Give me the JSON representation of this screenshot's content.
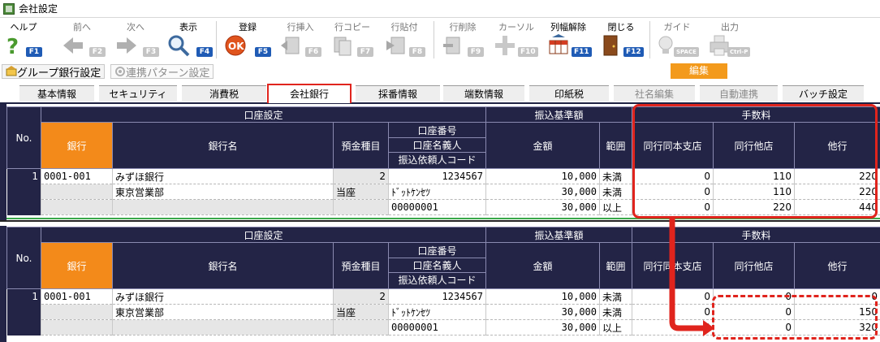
{
  "window": {
    "title": "会社設定"
  },
  "toolbar": {
    "items": [
      {
        "label": "ヘルプ",
        "key": "F1",
        "enabled": true,
        "icon": "help-icon"
      },
      {
        "label": "前へ",
        "key": "F2",
        "enabled": false,
        "icon": "arrow-left-icon"
      },
      {
        "label": "次へ",
        "key": "F3",
        "enabled": false,
        "icon": "arrow-right-icon"
      },
      {
        "label": "表示",
        "key": "F4",
        "enabled": true,
        "icon": "magnifier-icon"
      },
      {
        "label": "登録",
        "key": "F5",
        "enabled": true,
        "icon": "ok-icon"
      },
      {
        "label": "行挿入",
        "key": "F6",
        "enabled": false,
        "icon": "row-insert-icon"
      },
      {
        "label": "行コピー",
        "key": "F7",
        "enabled": false,
        "icon": "row-copy-icon"
      },
      {
        "label": "行貼付",
        "key": "F8",
        "enabled": false,
        "icon": "row-paste-icon"
      },
      {
        "label": "行削除",
        "key": "F9",
        "enabled": false,
        "icon": "row-delete-icon"
      },
      {
        "label": "カーソル",
        "key": "F10",
        "enabled": false,
        "icon": "cursor-icon"
      },
      {
        "label": "列幅解除",
        "key": "F11",
        "enabled": true,
        "icon": "column-width-icon"
      },
      {
        "label": "閉じる",
        "key": "F12",
        "enabled": true,
        "icon": "door-icon"
      },
      {
        "label": "ガイド",
        "key": "SPACE",
        "enabled": false,
        "icon": "bulb-icon"
      },
      {
        "label": "出力",
        "key": "Ctrl-P",
        "enabled": false,
        "icon": "printer-icon"
      }
    ]
  },
  "subbar": {
    "group_bank_label": "グループ銀行設定",
    "link_pattern_label": "連携パターン設定",
    "edit_label": "編集"
  },
  "tabs": [
    {
      "label": "基本情報",
      "active": false,
      "enabled": true
    },
    {
      "label": "セキュリティ",
      "active": false,
      "enabled": true
    },
    {
      "label": "消費税",
      "active": false,
      "enabled": true
    },
    {
      "label": "会社銀行",
      "active": true,
      "enabled": true
    },
    {
      "label": "採番情報",
      "active": false,
      "enabled": true
    },
    {
      "label": "端数情報",
      "active": false,
      "enabled": true
    },
    {
      "label": "印紙税",
      "active": false,
      "enabled": true
    },
    {
      "label": "社名編集",
      "active": false,
      "enabled": false
    },
    {
      "label": "自動連携",
      "active": false,
      "enabled": false
    },
    {
      "label": "バッチ設定",
      "active": false,
      "enabled": true
    }
  ],
  "grid_header": {
    "no": "No.",
    "account_settings": "口座設定",
    "transfer_base": "振込基準額",
    "fee": "手数料",
    "bank": "銀行",
    "bank_name": "銀行名",
    "deposit_type": "預金種目",
    "account_no": "口座番号",
    "account_holder": "口座名義人",
    "requester_code": "振込依頼人コード",
    "amount": "金額",
    "range": "範囲",
    "same_bank_same_branch": "同行同本支店",
    "same_bank_other_branch": "同行他店",
    "other_bank": "他行"
  },
  "grid_top": {
    "row": {
      "no": "1",
      "bank_code": "0001-001",
      "bank_name": "みずほ銀行",
      "branch_name": "東京営業部",
      "deposit_code": "2",
      "deposit_type": "当座",
      "account_no": "1234567",
      "account_holder": "ﾄﾞｯﾄｹﾝｾﾂ",
      "requester_code": "00000001",
      "lines": [
        {
          "amount": "10,000",
          "range": "未満",
          "same_branch": "0",
          "other_branch": "110",
          "other_bank": "220"
        },
        {
          "amount": "30,000",
          "range": "未満",
          "same_branch": "0",
          "other_branch": "110",
          "other_bank": "220"
        },
        {
          "amount": "30,000",
          "range": "以上",
          "same_branch": "0",
          "other_branch": "220",
          "other_bank": "440"
        }
      ]
    }
  },
  "grid_bottom": {
    "row": {
      "no": "1",
      "bank_code": "0001-001",
      "bank_name": "みずほ銀行",
      "branch_name": "東京営業部",
      "deposit_code": "2",
      "deposit_type": "当座",
      "account_no": "1234567",
      "account_holder": "ﾄﾞｯﾄｹﾝｾﾂ",
      "requester_code": "00000001",
      "lines": [
        {
          "amount": "10,000",
          "range": "未満",
          "same_branch": "0",
          "other_branch": "0",
          "other_bank": "0"
        },
        {
          "amount": "30,000",
          "range": "未満",
          "same_branch": "0",
          "other_branch": "0",
          "other_bank": "150"
        },
        {
          "amount": "30,000",
          "range": "以上",
          "same_branch": "0",
          "other_branch": "0",
          "other_bank": "320"
        }
      ]
    }
  },
  "colors": {
    "header_bg": "#232446",
    "bank_header": "#f38a1a",
    "highlight": "#e0241d",
    "edit_button": "#f39a1c"
  }
}
